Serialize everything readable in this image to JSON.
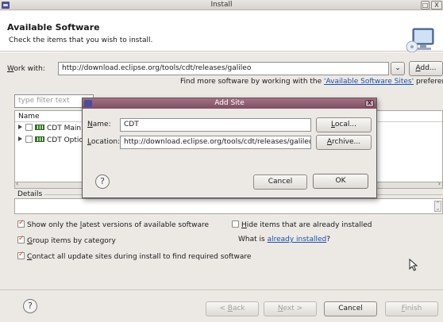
{
  "window": {
    "title": "Install",
    "minimize_label": "□",
    "close_label": "X"
  },
  "banner": {
    "title": "Available Software",
    "description": "Check the items that you wish to install."
  },
  "work_with": {
    "label_pre": "",
    "label_mnemonic": "W",
    "label_post": "ork with:",
    "url": "http://download.eclipse.org/tools/cdt/releases/galileo",
    "add_label_mnemonic": "A",
    "add_label_post": "dd...",
    "more_text": "Find more software by working with the ",
    "sites_link": "'Available Software Sites'",
    "more_text_post": " preferences."
  },
  "filter": {
    "placeholder": "type filter text"
  },
  "tree": {
    "column_name": "Name",
    "items": [
      {
        "label": "CDT Main"
      },
      {
        "label": "CDT Optio"
      }
    ]
  },
  "details": {
    "label": "Details"
  },
  "options": {
    "show_latest_pre": "Show only the ",
    "show_latest_mn": "l",
    "show_latest_post": "atest versions of available software",
    "hide_installed_mn": "H",
    "hide_installed_post": "ide items that are already installed",
    "group_mn": "G",
    "group_post": "roup items by category",
    "what_installed_pre": "What is ",
    "what_installed_link": "already installed",
    "what_installed_post": "?",
    "contact_mn": "C",
    "contact_post": "ontact all update sites during install to find required software"
  },
  "buttons": {
    "back": "< Back",
    "back_mn": "B",
    "next": "Next >",
    "next_mn": "N",
    "cancel": "Cancel",
    "finish": "Finish",
    "finish_mn": "F",
    "help": "?"
  },
  "dialog": {
    "title": "Add Site",
    "close_label": "X",
    "name_label_mn": "N",
    "name_label_post": "ame:",
    "name_value": "CDT",
    "location_label_mn": "L",
    "location_label_post": "ocation:",
    "location_value": "http://download.eclipse.org/tools/cdt/releases/galileo",
    "local_mn": "L",
    "local_post": "ocal...",
    "archive_mn": "A",
    "archive_post": "rchive...",
    "cancel": "Cancel",
    "ok": "OK",
    "help": "?"
  }
}
